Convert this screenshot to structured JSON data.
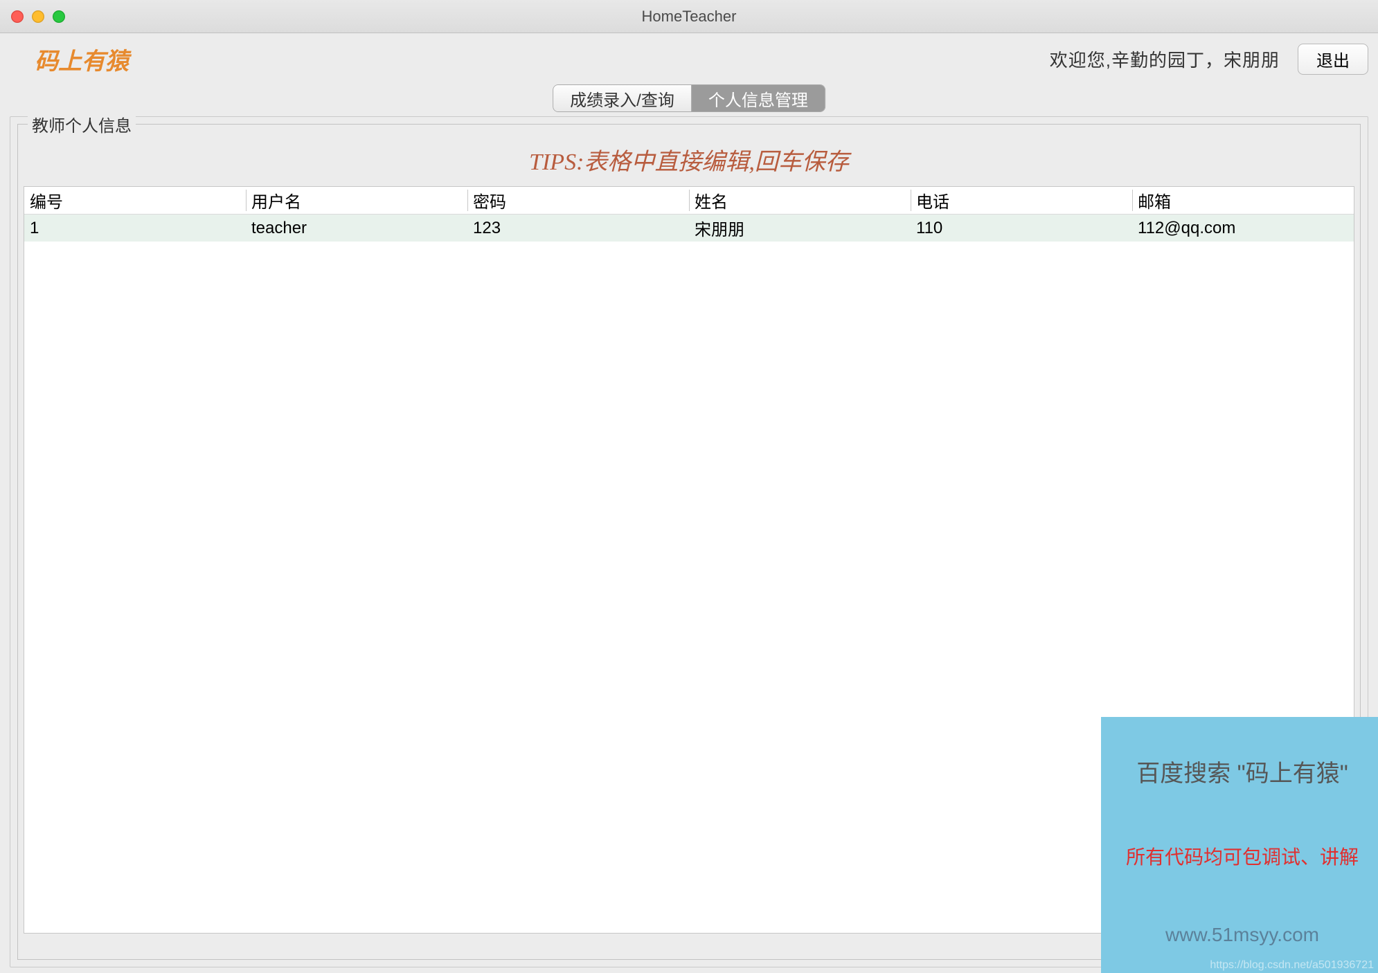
{
  "window": {
    "title": "HomeTeacher"
  },
  "header": {
    "brand": "码上有猿",
    "welcome": "欢迎您,辛勤的园丁，宋朋朋",
    "logout": "退出"
  },
  "tabs": {
    "items": [
      {
        "label": "成绩录入/查询",
        "active": false
      },
      {
        "label": "个人信息管理",
        "active": true
      }
    ]
  },
  "panel": {
    "legend": "教师个人信息",
    "tips": "TIPS:表格中直接编辑,回车保存"
  },
  "table": {
    "columns": [
      "编号",
      "用户名",
      "密码",
      "姓名",
      "电话",
      "邮箱"
    ],
    "rows": [
      {
        "id": "1",
        "username": "teacher",
        "password": "123",
        "name": "宋朋朋",
        "phone": "110",
        "email": "112@qq.com"
      }
    ]
  },
  "promo": {
    "line1": "百度搜索 \"码上有猿\"",
    "line2": "所有代码均可包调试、讲解",
    "line3": "www.51msyy.com",
    "credit": "https://blog.csdn.net/a501936721"
  }
}
